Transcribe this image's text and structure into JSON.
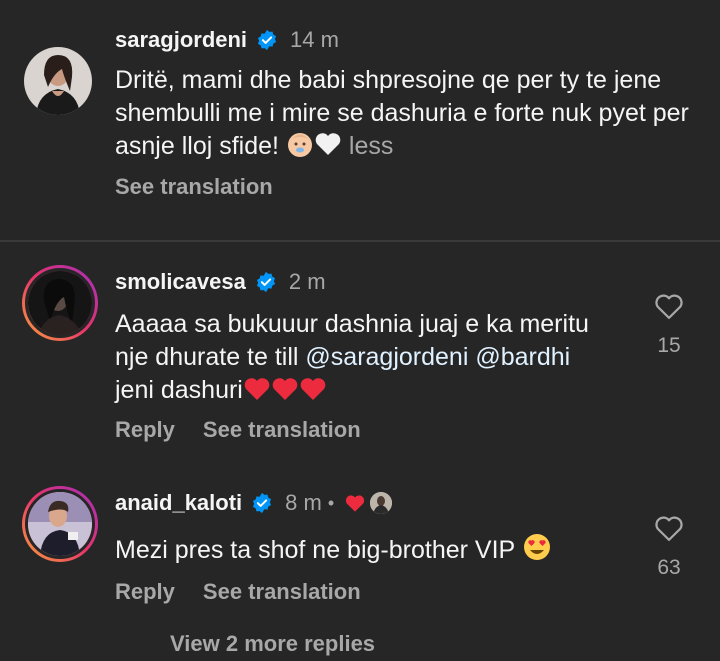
{
  "comments": [
    {
      "username": "saragjordeni",
      "time": "14 m",
      "text": "Dritë, mami dhe babi shpresojne qe per ty te jene shembulli me i mire se dashuria e forte nuk pyet per asnje lloj sfide!",
      "emojis": [
        "baby-emoji",
        "white-heart-emoji"
      ],
      "less_label": "less",
      "see_translation": "See translation"
    },
    {
      "username": "smolicavesa",
      "time": "2 m",
      "text_part1": "Aaaaa sa bukuuur dashnia juaj e ka meritu nje dhurate te till ",
      "mention1": "@saragjordeni",
      "mention2": "@bardhi",
      "text_part2": " jeni dashuri",
      "emojis": [
        "red-heart-emoji",
        "red-heart-emoji",
        "red-heart-emoji"
      ],
      "reply": "Reply",
      "see_translation": "See translation",
      "likes": "15"
    },
    {
      "username": "anaid_kaloti",
      "time": "8 m",
      "dot": "•",
      "text": "Mezi pres ta shof ne big-brother VIP",
      "emojis": [
        "heart-eyes-emoji"
      ],
      "reply": "Reply",
      "see_translation": "See translation",
      "likes": "63"
    }
  ],
  "view_more": "View 2 more replies",
  "colors": {
    "background": "#262626",
    "verified": "#0095f6",
    "secondary_text": "#a8a8a8",
    "heart_red": "#ed2b3e"
  }
}
